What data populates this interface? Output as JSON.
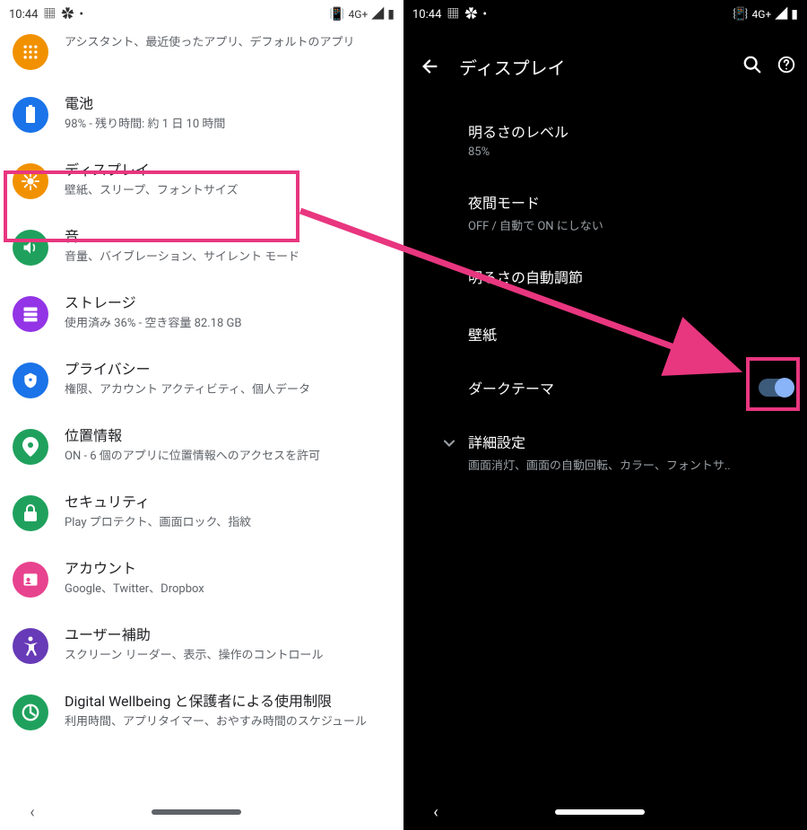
{
  "status": {
    "time": "10:44",
    "network": "4G+"
  },
  "left": {
    "partial_sub": "アシスタント、最近使ったアプリ、デフォルトのアプリ",
    "items": [
      {
        "title": "電池",
        "sub": "98% - 残り時間: 約 1 日 10 時間"
      },
      {
        "title": "ディスプレイ",
        "sub": "壁紙、スリープ、フォントサイズ"
      },
      {
        "title": "音",
        "sub": "音量、バイブレーション、サイレント モード"
      },
      {
        "title": "ストレージ",
        "sub": "使用済み 36% - 空き容量 82.18 GB"
      },
      {
        "title": "プライバシー",
        "sub": "権限、アカウント アクティビティ、個人データ"
      },
      {
        "title": "位置情報",
        "sub": "ON - 6 個のアプリに位置情報へのアクセスを許可"
      },
      {
        "title": "セキュリティ",
        "sub": "Play プロテクト、画面ロック、指紋"
      },
      {
        "title": "アカウント",
        "sub": "Google、Twitter、Dropbox"
      },
      {
        "title": "ユーザー補助",
        "sub": "スクリーン リーダー、表示、操作のコントロール"
      },
      {
        "title": "Digital Wellbeing と保護者による使用制限",
        "sub": "利用時間、アプリタイマー、おやすみ時間のスケジュール"
      }
    ]
  },
  "right": {
    "title": "ディスプレイ",
    "items": {
      "brightness": {
        "title": "明るさのレベル",
        "sub": "85%"
      },
      "night": {
        "title": "夜間モード",
        "sub": "OFF / 自動で ON にしない"
      },
      "auto_brightness": {
        "title": "明るさの自動調節",
        "sub": ""
      },
      "wallpaper": {
        "title": "壁紙"
      },
      "dark_theme": {
        "title": "ダークテーマ"
      },
      "advanced": {
        "title": "詳細設定",
        "sub": "画面消灯、画面の自動回転、カラー、フォントサ.."
      }
    }
  }
}
